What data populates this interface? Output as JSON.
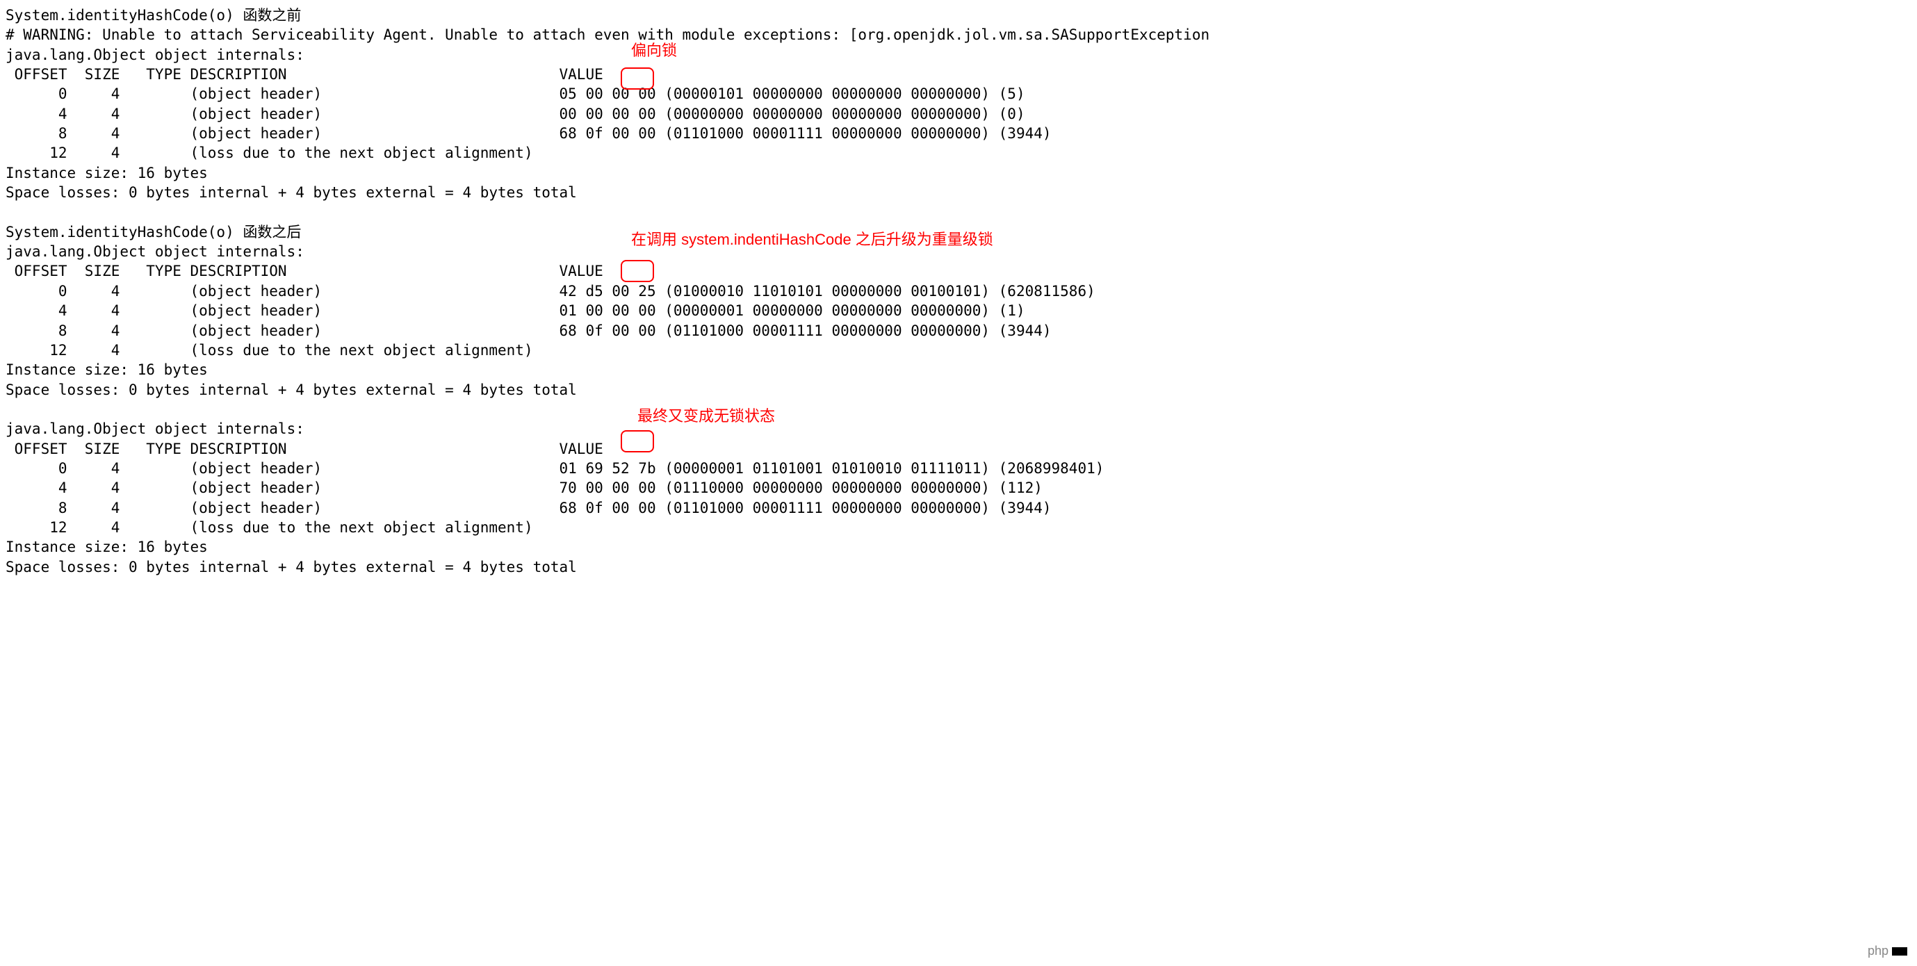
{
  "annotations": {
    "a1": "偏向锁",
    "a2": "在调用 system.indentiHashCode 之后升级为重量级锁",
    "a3": "最终又变成无锁状态"
  },
  "watermark": "php",
  "block1": {
    "title": "System.identityHashCode(o) 函数之前",
    "warn": "# WARNING: Unable to attach Serviceability Agent. Unable to attach even with module exceptions: [org.openjdk.jol.vm.sa.SASupportException",
    "internals": "java.lang.Object object internals:",
    "header": " OFFSET  SIZE   TYPE DESCRIPTION                               VALUE",
    "rows": [
      "      0     4        (object header)                           05 00 00 00 (00000101 00000000 00000000 00000000) (5)",
      "      4     4        (object header)                           00 00 00 00 (00000000 00000000 00000000 00000000) (0)",
      "      8     4        (object header)                           68 0f 00 00 (01101000 00001111 00000000 00000000) (3944)",
      "     12     4        (loss due to the next object alignment)"
    ],
    "size": "Instance size: 16 bytes",
    "losses": "Space losses: 0 bytes internal + 4 bytes external = 4 bytes total"
  },
  "block2": {
    "title": "System.identityHashCode(o) 函数之后",
    "internals": "java.lang.Object object internals:",
    "header": " OFFSET  SIZE   TYPE DESCRIPTION                               VALUE",
    "rows": [
      "      0     4        (object header)                           42 d5 00 25 (01000010 11010101 00000000 00100101) (620811586)",
      "      4     4        (object header)                           01 00 00 00 (00000001 00000000 00000000 00000000) (1)",
      "      8     4        (object header)                           68 0f 00 00 (01101000 00001111 00000000 00000000) (3944)",
      "     12     4        (loss due to the next object alignment)"
    ],
    "size": "Instance size: 16 bytes",
    "losses": "Space losses: 0 bytes internal + 4 bytes external = 4 bytes total"
  },
  "block3": {
    "internals": "java.lang.Object object internals:",
    "header": " OFFSET  SIZE   TYPE DESCRIPTION                               VALUE",
    "rows": [
      "      0     4        (object header)                           01 69 52 7b (00000001 01101001 01010010 01111011) (2068998401)",
      "      4     4        (object header)                           70 00 00 00 (01110000 00000000 00000000 00000000) (112)",
      "      8     4        (object header)                           68 0f 00 00 (01101000 00001111 00000000 00000000) (3944)",
      "     12     4        (loss due to the next object alignment)"
    ],
    "size": "Instance size: 16 bytes",
    "losses": "Space losses: 0 bytes internal + 4 bytes external = 4 bytes total"
  }
}
